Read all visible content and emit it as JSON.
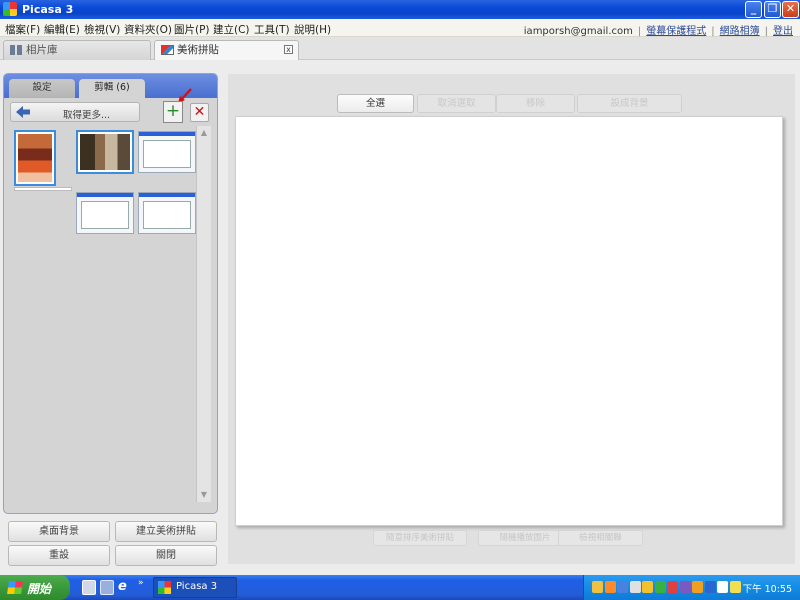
{
  "window": {
    "title": "Picasa 3",
    "buttons": {
      "minimize": "_",
      "restore": "❐",
      "close": "✕"
    }
  },
  "menu": {
    "items": [
      "檔案(F)",
      "編輯(E)",
      "檢視(V)",
      "資料夾(O)",
      "圖片(P)",
      "建立(C)",
      "工具(T)",
      "說明(H)"
    ],
    "account_email": "iamporsh@gmail.com",
    "screensaver_link": "螢幕保護程式",
    "web_albums_link": "網路相簿",
    "logout_link": "登出"
  },
  "tabs": [
    {
      "label": "相片庫",
      "icon": "library-grid-icon",
      "active": false
    },
    {
      "label": "美術拼貼",
      "icon": "collage-icon",
      "active": true,
      "close": "x"
    }
  ],
  "left_panel": {
    "tabs": [
      {
        "label": "設定",
        "active": false
      },
      {
        "label": "剪輯 (6)",
        "active": true
      }
    ],
    "get_more_label": "取得更多...",
    "add_icon": "plus-icon",
    "remove_icon": "x-icon",
    "add_glyph": "+",
    "remove_glyph": "✕",
    "thumbnails": [
      {
        "kind": "photo",
        "selected": true
      },
      {
        "kind": "photo",
        "selected": true
      },
      {
        "kind": "screenshot",
        "selected": false
      },
      {
        "kind": "screenshot",
        "selected": false
      },
      {
        "kind": "screenshot",
        "selected": false
      }
    ],
    "buttons": {
      "desktop_background": "桌面背景",
      "create_collage": "建立美術拼貼",
      "reset": "重設",
      "close": "關閉"
    }
  },
  "canvas_panel": {
    "top_buttons": {
      "select_all": "全選",
      "deselect": "取消選取",
      "remove": "移除",
      "set_background": "設成背景"
    },
    "bottom_buttons": {
      "random_collage": "隨意排序美術拼貼",
      "random_rotate": "隨機播放圖片",
      "swap_order": "檢視相關聯"
    }
  },
  "taskbar": {
    "start_label": "開始",
    "more": "»",
    "task_label": "Picasa 3",
    "clock": "下午 10:55",
    "tray_colors": [
      "#f0c040",
      "#ff8a2a",
      "#4a80e0",
      "#e0e0e0",
      "#f2c12e",
      "#3ab040",
      "#e04040",
      "#7a5ac0",
      "#f0a020",
      "#2a66d0",
      "#ffffff",
      "#f0e050"
    ]
  },
  "colors": {
    "title_bar": "#0a4ad8",
    "accent_selection": "#3c8cdc",
    "add_button": "#2a8a2a",
    "remove_button": "#c01818"
  }
}
